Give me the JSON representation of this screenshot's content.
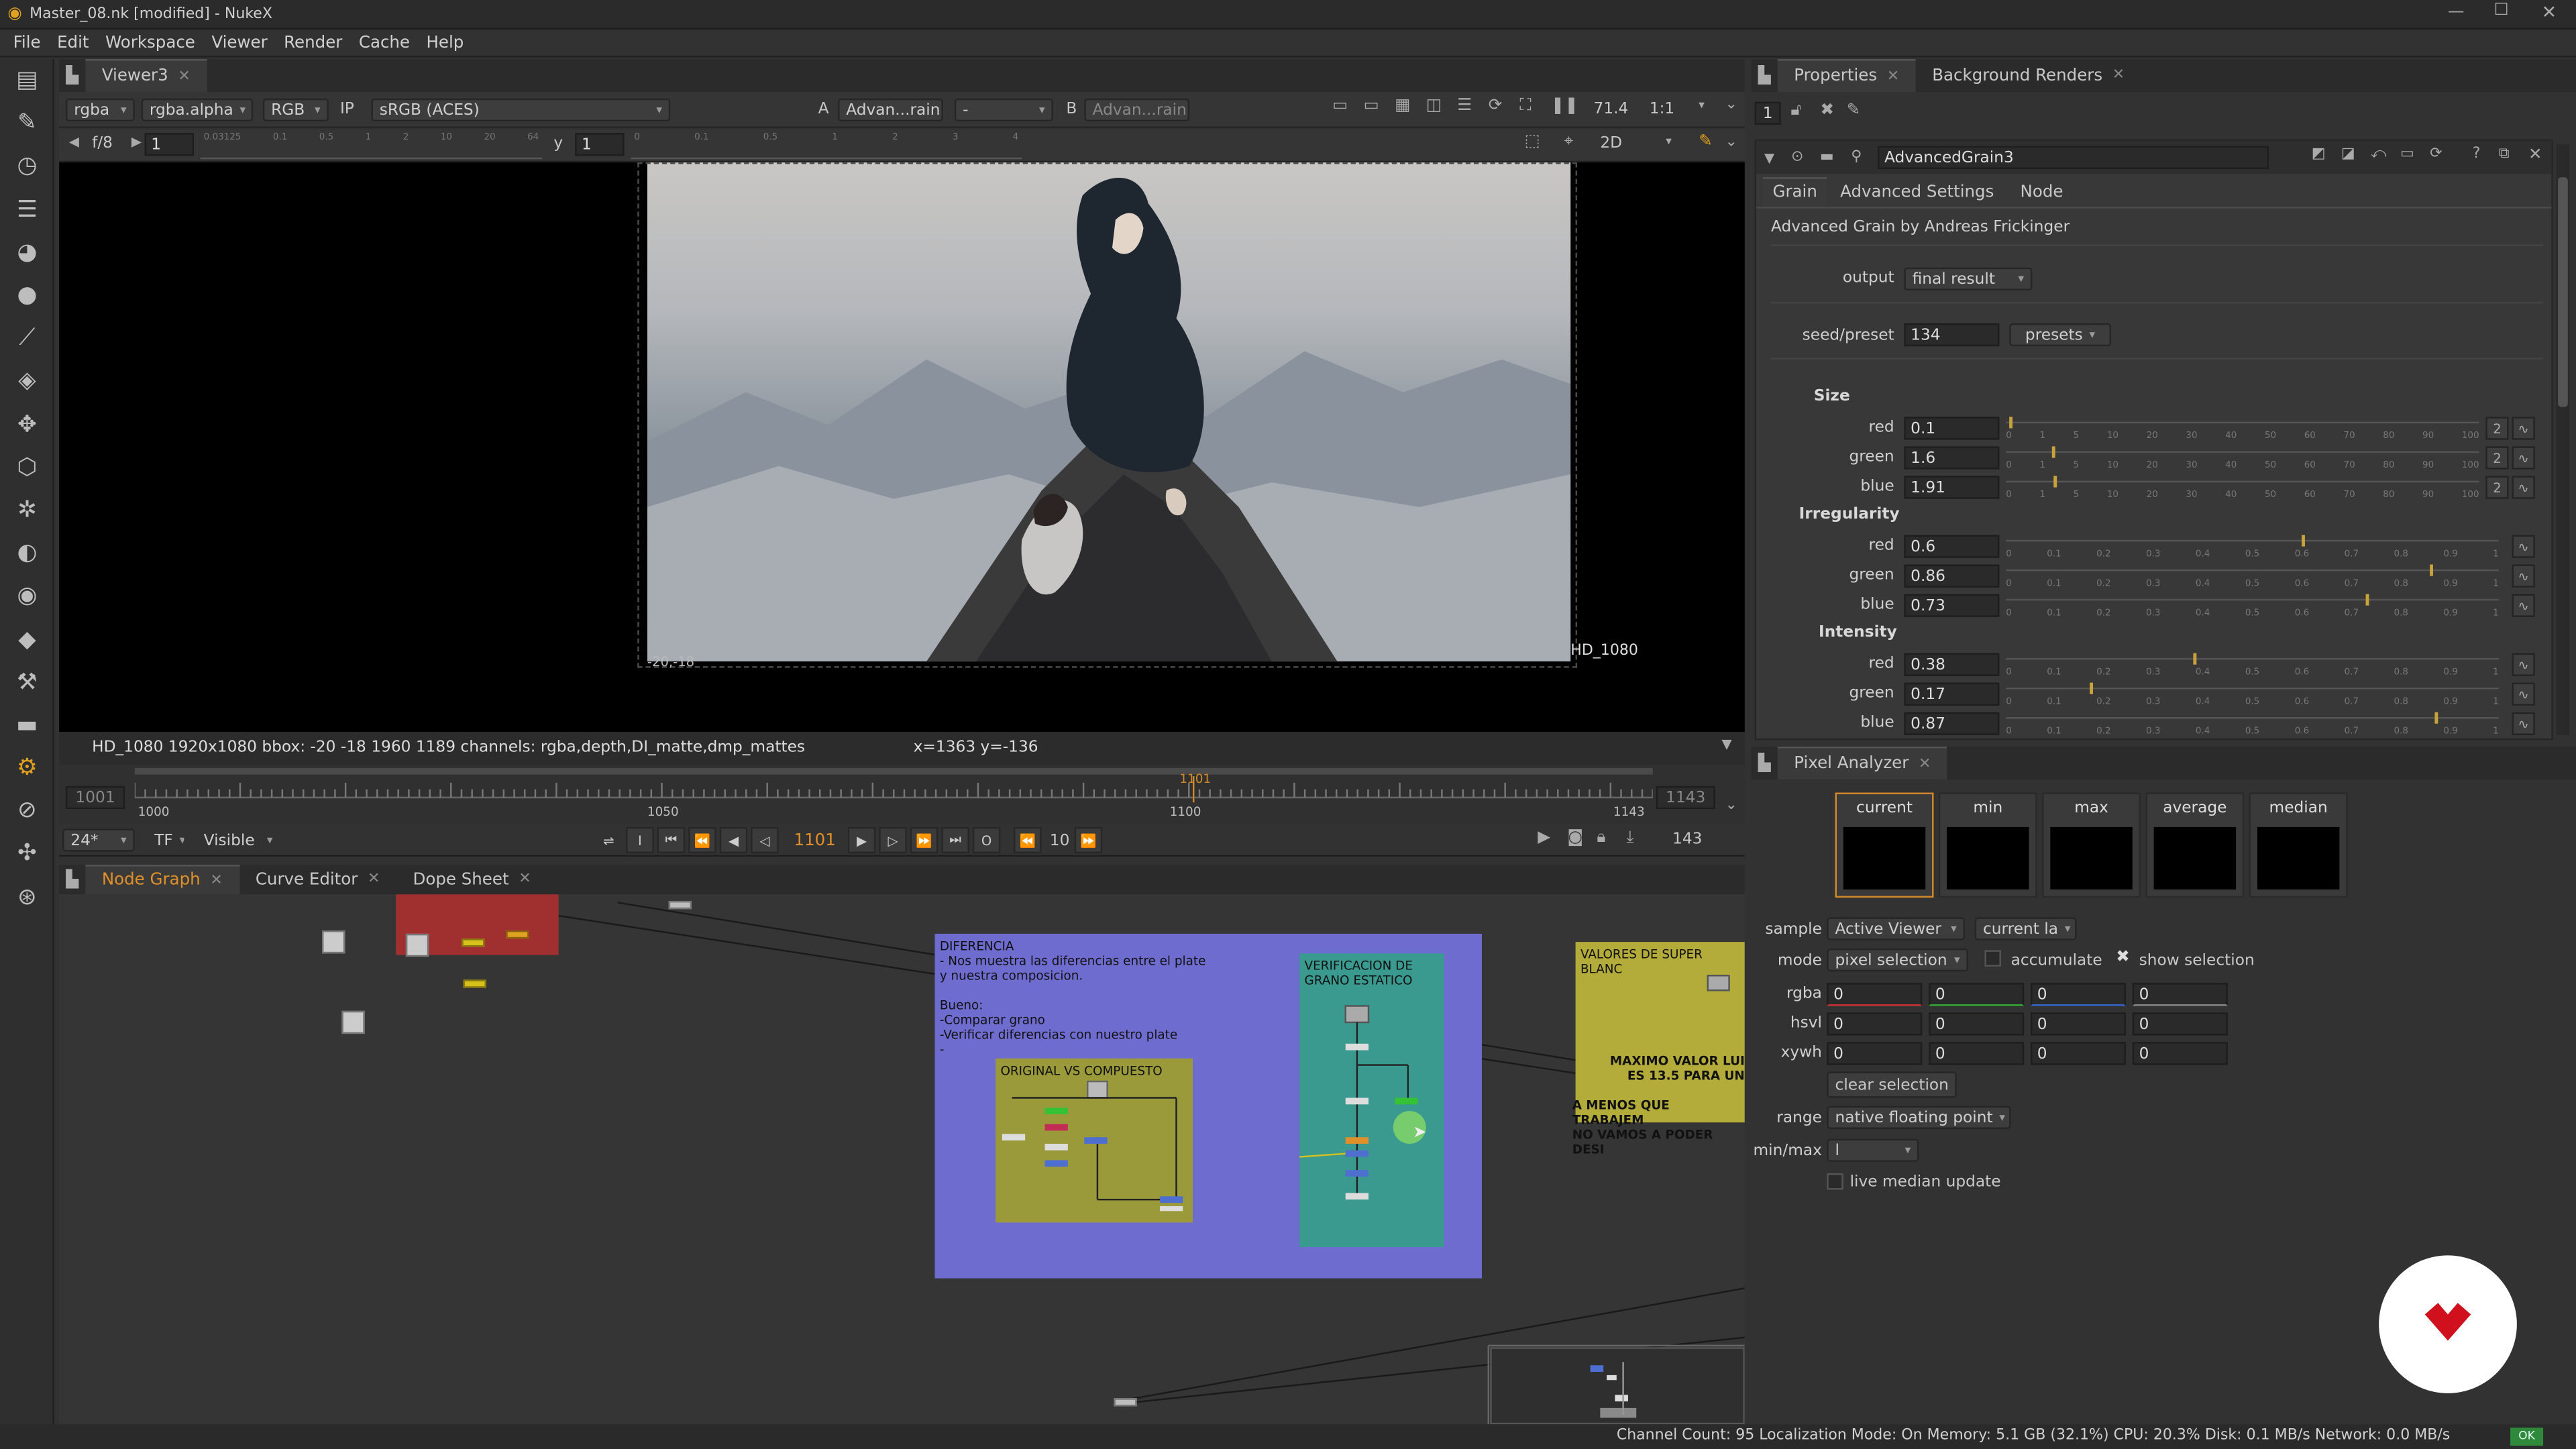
{
  "window": {
    "title": "Master_08.nk [modified] - NukeX"
  },
  "menu": [
    "File",
    "Edit",
    "Workspace",
    "Viewer",
    "Render",
    "Cache",
    "Help"
  ],
  "viewer": {
    "tab": "Viewer3",
    "channels": "rgba",
    "alpha": "rgba.alpha",
    "display": "RGB",
    "ip": "IP",
    "colorspace": "sRGB (ACES)",
    "input_a_label": "A",
    "input_a": "Advan...rain3",
    "dash": "-",
    "input_b_label": "B",
    "input_b": "Advan...rain3",
    "zoom": "71.4",
    "ratio": "1:1",
    "fstop": "f/8",
    "gain": "1",
    "gamma_label": "y",
    "gamma": "1",
    "mode2d": "2D",
    "format_label": "HD_1080",
    "info_text": "HD_1080 1920x1080  bbox: -20 -18 1960 1189 channels: rgba,depth,DI_matte,dmp_mattes",
    "coords_text": "x=1363 y=-136",
    "corner_label": "-20,-18"
  },
  "timeline": {
    "start_in": "1001",
    "end_out": "1143",
    "ticks": [
      "1000",
      "1050",
      "1100",
      "1143"
    ],
    "current_marker": "1101",
    "fps": "24*",
    "tf": "TF",
    "visible": "Visible",
    "current_frame": "1101",
    "step": "10",
    "end_frame": "143"
  },
  "panels": {
    "nodegraph_tabs": [
      "Node Graph",
      "Curve Editor",
      "Dope Sheet"
    ],
    "properties_tabs": [
      "Properties",
      "Background Renders"
    ],
    "pixel_analyzer_tab": "Pixel Analyzer"
  },
  "nodegraph": {
    "backdrop_main_title": "DIFERENCIA\n- Nos muestra las diferencias entre el plate\ny nuestra composicion.\n\nBueno:\n-Comparar grano\n-Verificar diferencias con nuestro plate\n-",
    "backdrop_compare": "ORIGINAL VS COMPUESTO",
    "backdrop_verify": "VERIFICACION DE\nGRANO ESTATICO",
    "backdrop_values": "VALORES DE  SUPER BLANC",
    "backdrop_values_sub": "MAXIMO VALOR LUI\nES 13.5 PARA UN",
    "backdrop_values_sub2": "A MENOS QUE TRABAJEM\nNO VAMOS A PODER DESI"
  },
  "properties": {
    "stack_count": "1",
    "node_name": "AdvancedGrain3",
    "tabs": [
      "Grain",
      "Advanced Settings",
      "Node"
    ],
    "description": "Advanced Grain by Andreas Frickinger",
    "output_label": "output",
    "output_value": "final result",
    "seed_label": "seed/preset",
    "seed_value": "134",
    "presets": "presets",
    "size_section": "Size",
    "size": [
      {
        "label": "red",
        "value": "0.1",
        "pos": 0.1
      },
      {
        "label": "green",
        "value": "1.6",
        "pos": 1.6
      },
      {
        "label": "blue",
        "value": "1.91",
        "pos": 1.91
      }
    ],
    "size_ticks": [
      "0",
      "1",
      "5",
      "10",
      "20",
      "30",
      "40",
      "50",
      "60",
      "70",
      "80",
      "90",
      "100"
    ],
    "size_count": "2",
    "irregularity_section": "Irregularity",
    "irregularity": [
      {
        "label": "red",
        "value": "0.6",
        "pos": 0.6
      },
      {
        "label": "green",
        "value": "0.86",
        "pos": 0.86
      },
      {
        "label": "blue",
        "value": "0.73",
        "pos": 0.73
      }
    ],
    "intensity_section": "Intensity",
    "intensity": [
      {
        "label": "red",
        "value": "0.38",
        "pos": 0.38
      },
      {
        "label": "green",
        "value": "0.17",
        "pos": 0.17
      },
      {
        "label": "blue",
        "value": "0.87",
        "pos": 0.87
      }
    ],
    "unit_ticks": [
      "0",
      "0.1",
      "0.2",
      "0.3",
      "0.4",
      "0.5",
      "0.6",
      "0.7",
      "0.8",
      "0.9",
      "1"
    ]
  },
  "pixel_analyzer": {
    "swatches": [
      "current",
      "min",
      "max",
      "average",
      "median"
    ],
    "sample_label": "sample",
    "sample_value": "Active Viewer",
    "sample_layer": "current la",
    "mode_label": "mode",
    "mode_value": "pixel selection",
    "accumulate": "accumulate",
    "show_selection": "show selection",
    "rows": [
      {
        "label": "rgba",
        "values": [
          "0",
          "0",
          "0",
          "0"
        ]
      },
      {
        "label": "hsvl",
        "values": [
          "0",
          "0",
          "0",
          "0"
        ]
      },
      {
        "label": "xywh",
        "values": [
          "0",
          "0",
          "0",
          "0"
        ]
      }
    ],
    "clear_selection": "clear selection",
    "range_label": "range",
    "range_value": "native floating point",
    "minmax_label": "min/max",
    "minmax_value": "l",
    "live_median": "live median update"
  },
  "statusbar": {
    "text": "Channel Count: 95  Localization Mode: On  Memory: 5.1 GB (32.1%)  CPU: 20.3%  Disk: 0.1 MB/s  Network: 0.0 MB/s",
    "ok": "OK"
  },
  "colors": {
    "accent": "#d08a2a",
    "backdrop_purple": "#6f6ccf",
    "backdrop_olive": "#9a9a3a",
    "backdrop_teal": "#3a9a8f",
    "backdrop_red": "#a03030",
    "logo_red": "#d0101c"
  }
}
